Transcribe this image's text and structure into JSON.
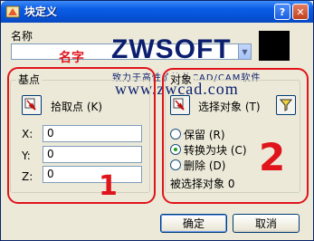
{
  "window": {
    "title": "块定义"
  },
  "titlebar": {
    "help_label": "?",
    "close_label": "✕"
  },
  "name_section": {
    "label": "名称",
    "value": "",
    "annotation": "名字"
  },
  "basepoint": {
    "title": "基点",
    "pick_label": "拾取点 (K)",
    "x_label": "X:",
    "x_value": "0",
    "y_label": "Y:",
    "y_value": "0",
    "z_label": "Z:",
    "z_value": "0"
  },
  "objects": {
    "title": "对象",
    "select_label": "选择对象 (T)",
    "options": [
      {
        "label": "保留 (R)",
        "checked": false
      },
      {
        "label": "转换为块 (C)",
        "checked": true
      },
      {
        "label": "删除 (D)",
        "checked": false
      }
    ],
    "selected_count_label": "被选择对象 0"
  },
  "buttons": {
    "ok": "确定",
    "cancel": "取消"
  },
  "annotations": {
    "mark_1": "1",
    "mark_2": "2"
  },
  "watermark": {
    "logo": "ZWSOFT",
    "tagline": "致力于高性价比的CAD/CAM软件",
    "url": "www.zwcad.com"
  },
  "colors": {
    "annotation_red": "#e0141b",
    "title_blue": "#0553d8",
    "logo_navy": "#0c1f6f"
  }
}
